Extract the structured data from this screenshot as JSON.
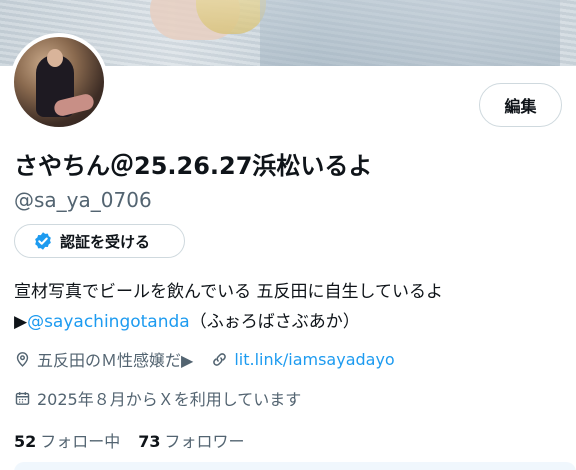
{
  "profile": {
    "display_name": "さやちん＠25.26.27浜松いるよ",
    "handle": "@sa_ya_0706",
    "edit_label": "編集",
    "verify_label": "認証を受ける",
    "bio_line1": "宣材写真でビールを飲んでいる 五反田に自生しているよ",
    "bio_line2_prefix": "▶",
    "bio_mention": "@sayachingotanda",
    "bio_line2_suffix": "（ふぉろばさぶあか）",
    "location": "五反田のＭ性感嬢だ▶",
    "website": "lit.link/iamsayadayo",
    "joined": "2025年８月からＸを利用しています",
    "following_count": "52",
    "following_label": "フォロー中",
    "followers_count": "73",
    "followers_label": "フォロワー"
  },
  "icons": {
    "verify": "verified-badge-icon",
    "location": "location-pin-icon",
    "link": "link-icon",
    "calendar": "calendar-icon"
  },
  "colors": {
    "accent": "#1d9bf0",
    "muted_text": "#536471",
    "text": "#0f1419",
    "border": "#cfd9de"
  }
}
